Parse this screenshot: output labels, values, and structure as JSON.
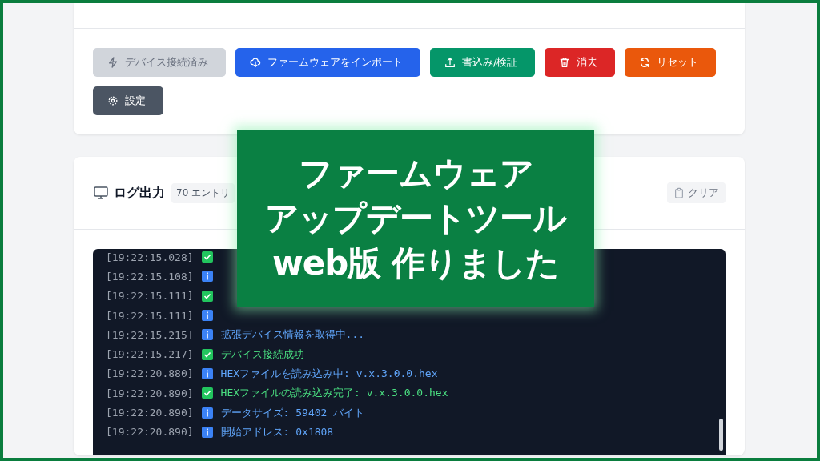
{
  "toolbar": {
    "buttons": [
      {
        "label": "デバイス接続済み",
        "kind": "bolt",
        "color": "#d1d5db",
        "disabled": true
      },
      {
        "label": "ファームウェアをインポート",
        "kind": "cloud",
        "color": "#2563eb",
        "disabled": false
      },
      {
        "label": "書込み/検証",
        "kind": "upload",
        "color": "#059669",
        "disabled": false
      },
      {
        "label": "消去",
        "kind": "trash",
        "color": "#dc2626",
        "disabled": false
      },
      {
        "label": "リセット",
        "kind": "refresh",
        "color": "#ea580c",
        "disabled": false
      },
      {
        "label": "設定",
        "kind": "gear",
        "color": "#4b5563",
        "disabled": false
      }
    ]
  },
  "log_panel": {
    "title": "ログ出力",
    "count": "70 エントリ",
    "clear_button": "クリア",
    "entries": [
      {
        "time": "[19:22:15.028]",
        "kind": "success"
      },
      {
        "time": "[19:22:15.108]",
        "kind": "info"
      },
      {
        "time": "[19:22:15.111]",
        "kind": "success"
      },
      {
        "time": "[19:22:15.111]",
        "kind": "info"
      },
      {
        "time": "[19:22:15.215]",
        "kind": "info",
        "message": "拡張デバイス情報を取得中..."
      },
      {
        "time": "[19:22:15.217]",
        "kind": "success",
        "message": "デバイス接続成功"
      },
      {
        "time": "[19:22:20.880]",
        "kind": "info",
        "message": "HEXファイルを読み込み中: v.x.3.0.0.hex"
      },
      {
        "time": "[19:22:20.890]",
        "kind": "success",
        "message": "HEXファイルの読み込み完了: v.x.3.0.0.hex"
      },
      {
        "time": "[19:22:20.890]",
        "kind": "info",
        "message": "データサイズ: 59402 バイト"
      },
      {
        "time": "[19:22:20.890]",
        "kind": "info",
        "message": "開始アドレス: 0x1808"
      }
    ]
  },
  "banner": {
    "lines": [
      "ファームウェア",
      "アップデートツール",
      "web版 作りました"
    ]
  }
}
